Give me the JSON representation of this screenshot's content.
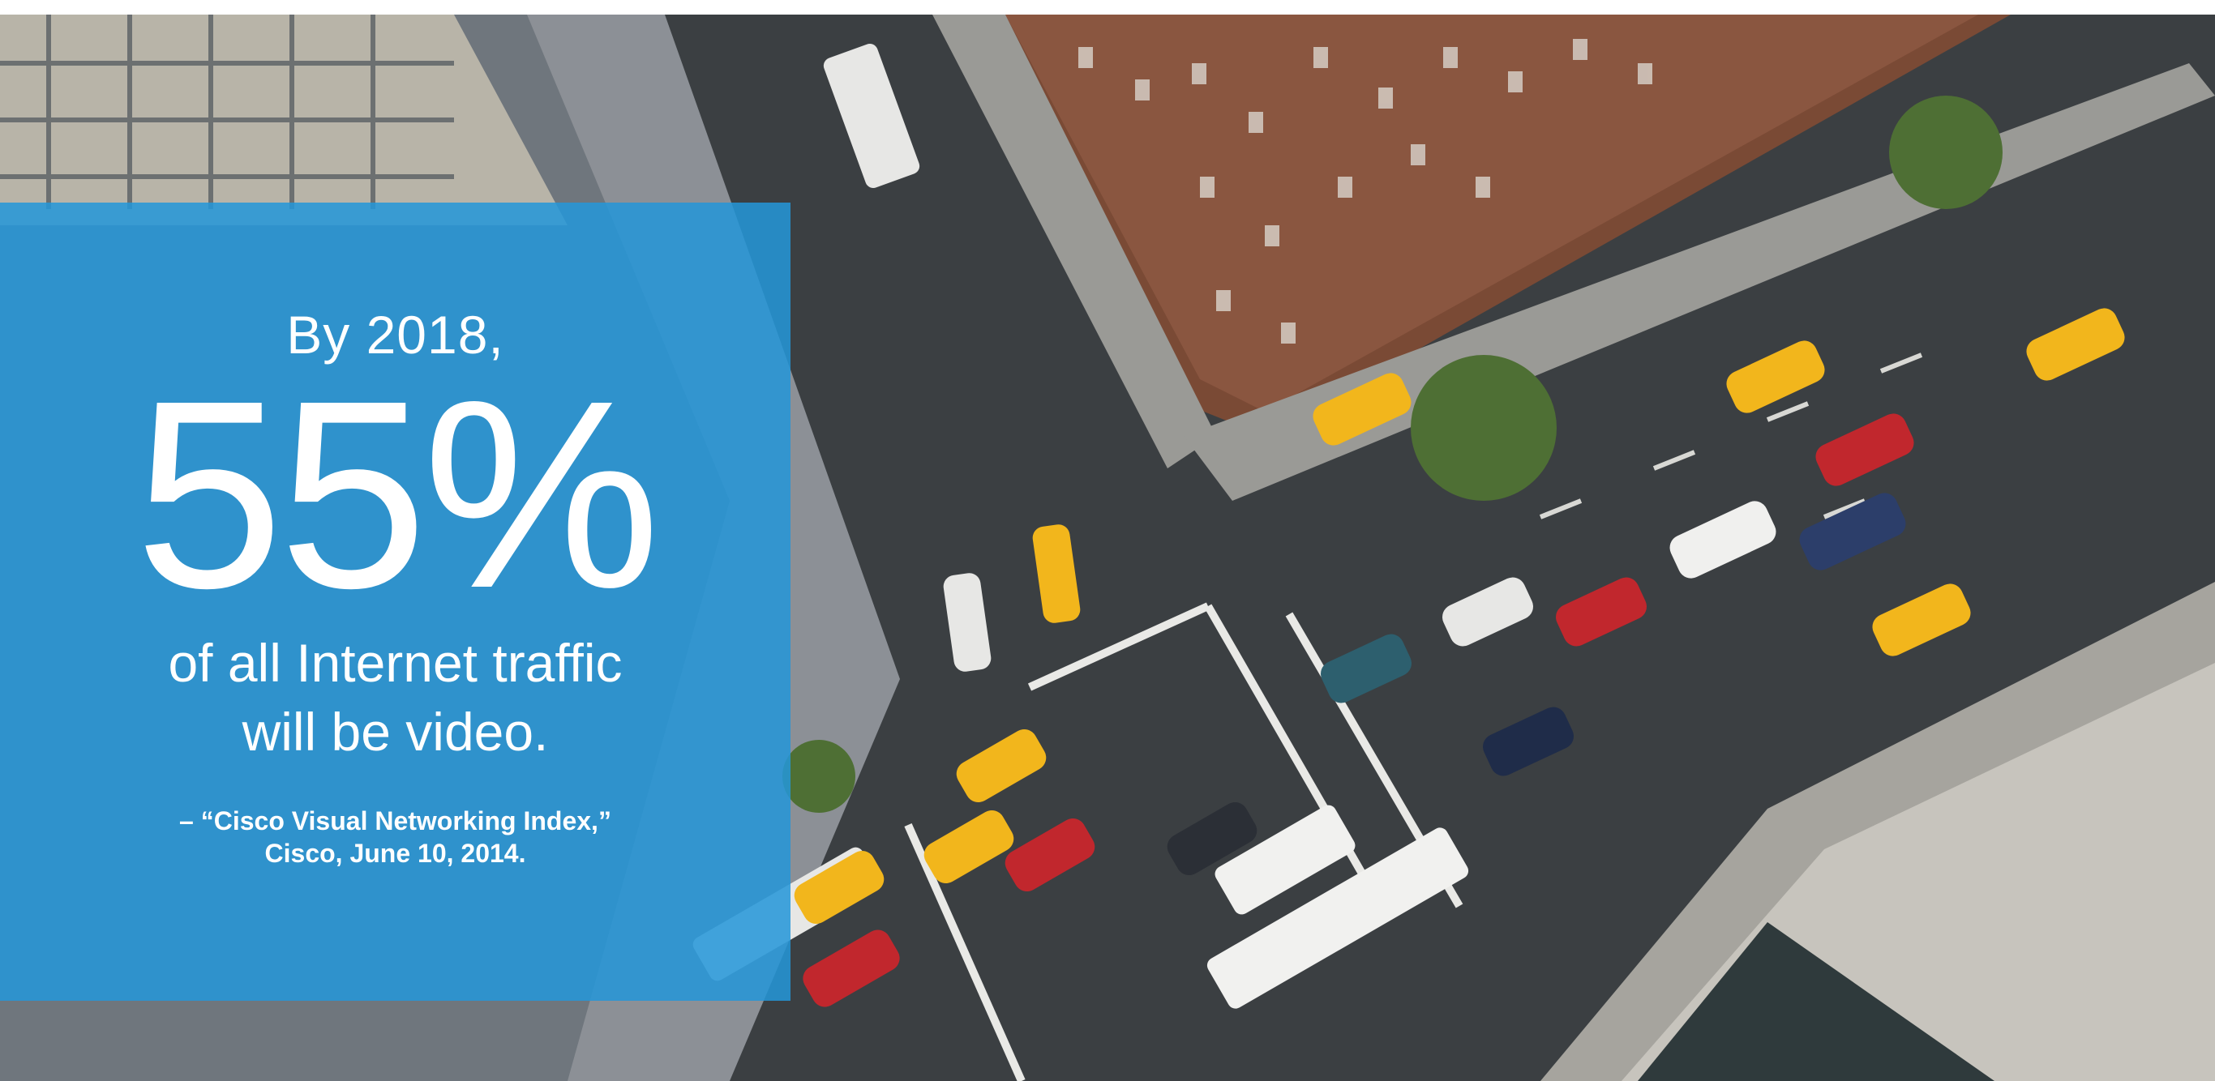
{
  "quote": {
    "lead": "By 2018,",
    "stat": "55%",
    "line1": "of all Internet traffic",
    "line2": "will be video.",
    "citation_line1": "– “Cisco Visual Networking Index,”",
    "citation_line2": "Cisco, June 10, 2014."
  },
  "colors": {
    "panel_blue": "#2496d8",
    "text": "#ffffff",
    "road": "#3a3d3f",
    "brick": "#7a4a35",
    "taxi": "#f2b61c"
  }
}
